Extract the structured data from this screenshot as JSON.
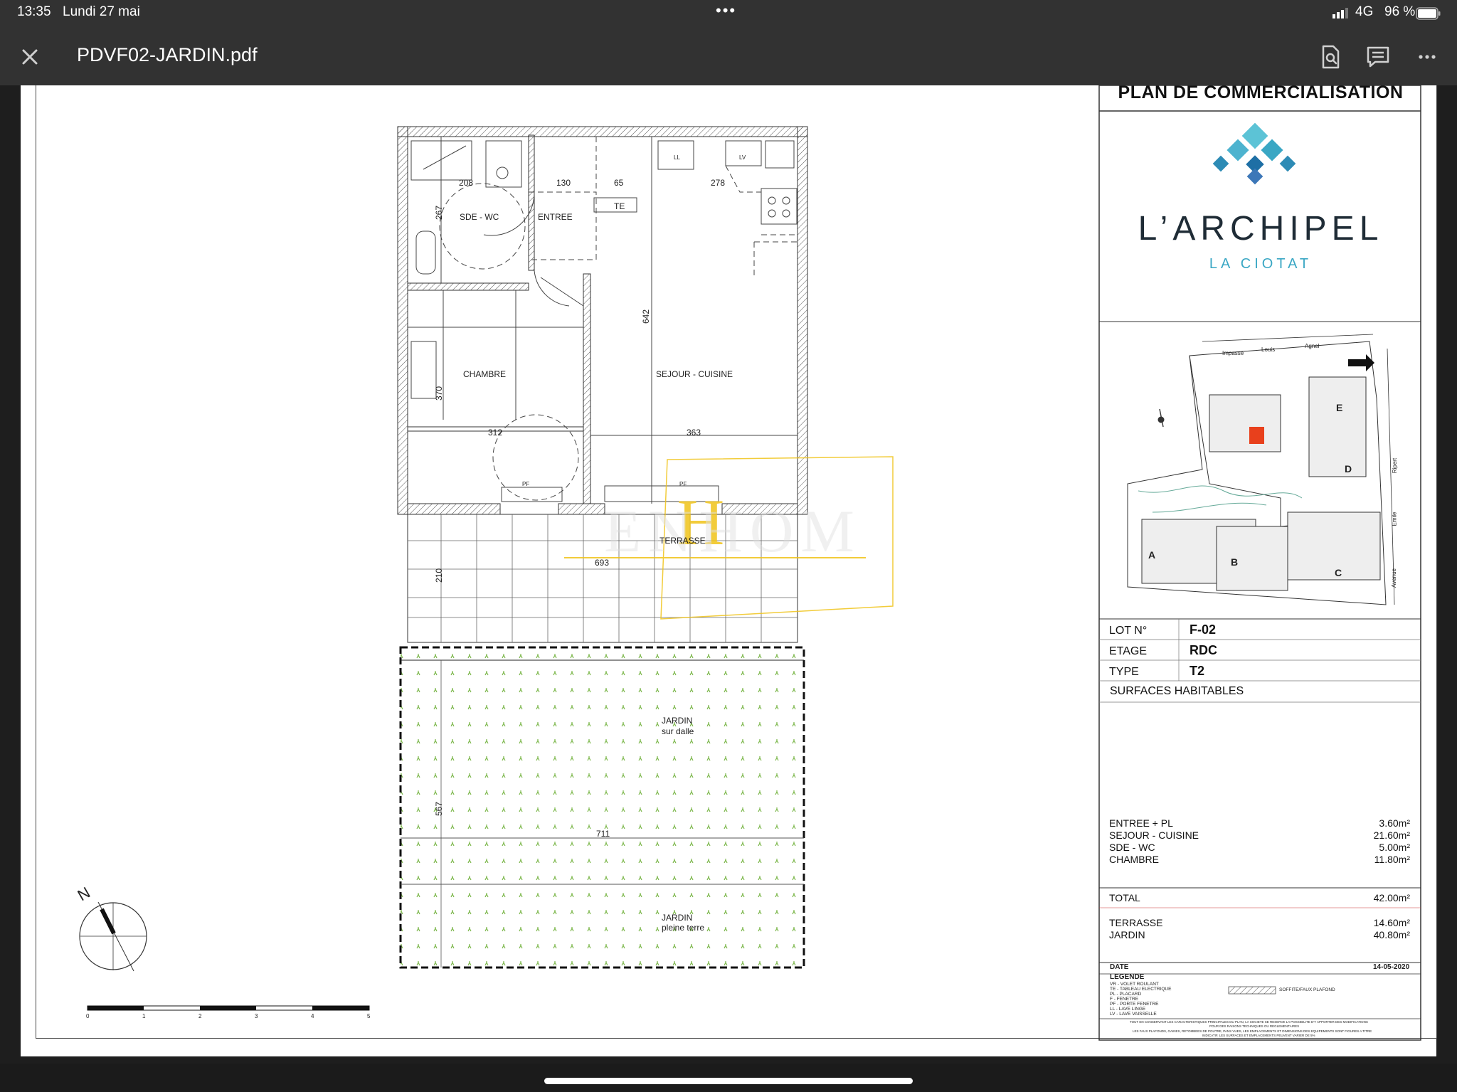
{
  "status": {
    "time": "13:35",
    "date": "Lundi 27 mai",
    "dots": "•••",
    "network": "4G",
    "battery": "96 %"
  },
  "toolbar": {
    "close_icon": "close-icon",
    "file_name": "PDVF02-JARDIN.pdf",
    "search_icon": "search-document-icon",
    "annotate_icon": "comment-icon",
    "more_icon": "more-icon"
  },
  "plan": {
    "rooms": {
      "sde_wc": "SDE - WC",
      "entree": "ENTREE",
      "te": "TE",
      "chambre": "CHAMBRE",
      "sejour": "SEJOUR - CUISINE",
      "terrasse": "TERRASSE",
      "jardin_dalle_1": "JARDIN",
      "jardin_dalle_2": "sur dalle",
      "jardin_terre_1": "JARDIN",
      "jardin_terre_2": "pleine terre"
    },
    "dims": {
      "d208": "208",
      "d130": "130",
      "d65": "65",
      "d278": "278",
      "d267": "267",
      "d642": "642",
      "d370": "370",
      "d312": "312",
      "d363": "363",
      "d693": "693",
      "d210": "210",
      "d567": "567",
      "d711": "711"
    },
    "fixtures": {
      "ll": "LL",
      "lv": "LV",
      "pf": "PF"
    },
    "compass_n": "N",
    "scale": [
      "0",
      "1",
      "2",
      "3",
      "4",
      "5"
    ]
  },
  "cartouche": {
    "title": "PLAN DE COMMERCIALISATION",
    "brand": "L’ARCHIPEL",
    "brand_sub": "LA CIOTAT",
    "map_labels": {
      "a": "A",
      "b": "B",
      "c": "C",
      "d": "D",
      "e": "E",
      "impasse": "Impasse",
      "louis": "Louis",
      "agnel": "Agnel",
      "ripert": "Ripert",
      "emile": "Emile",
      "avenue": "Avenue"
    },
    "lot_label": "LOT N°",
    "lot_value": "F-02",
    "etage_label": "ETAGE",
    "etage_value": "RDC",
    "type_label": "TYPE",
    "type_value": "T2",
    "surfaces_label": "SURFACES HABITABLES",
    "surfaces": [
      {
        "name": "ENTREE + PL",
        "value": "3.60m²"
      },
      {
        "name": "SEJOUR - CUISINE",
        "value": "21.60m²"
      },
      {
        "name": "SDE - WC",
        "value": "5.00m²"
      },
      {
        "name": "CHAMBRE",
        "value": "11.80m²"
      }
    ],
    "total_label": "TOTAL",
    "total_value": "42.00m²",
    "exterieurs": [
      {
        "name": "TERRASSE",
        "value": "14.60m²"
      },
      {
        "name": "JARDIN",
        "value": "40.80m²"
      }
    ],
    "date_label": "DATE",
    "date_value": "14-05-2020",
    "legende_label": "LEGENDE",
    "legend_items": [
      "VR - VOLET ROULANT",
      "TE - TABLEAU ELECTRIQUE",
      "PL - PLACARD",
      "F - FENETRE",
      "PF - PORTE FENETRE",
      "LL - LAVE LINGE",
      "LV - LAVE VAISSELLE"
    ],
    "legend_soffite": "SOFFITE/FAUX PLAFOND",
    "disclaimer_1": "TOUT EN CONSERVANT LES CARACTERISTIQUES PRINCIPALES DU PLAN, LA SOCIETE SE RESERVE LA POSSIBILITE D'Y APPORTER DES MODIFICATIONS",
    "disclaimer_2": "POUR DES RAISONS TECHNIQUES OU REGLEMENTAIRES",
    "disclaimer_3": "LES FAUX PLAFONDS, GAINES, RETOMBEES DE POUTRE, PANS VUES, LES EMPLACEMENTS ET DIMENSIONS DES EQUIPEMENTS SONT FIGURES A TITRE",
    "disclaimer_4": "INDICATIF. LES SURFACES ET EMPLACEMENTS PEUVENT VARIER DE 5%"
  },
  "colors": {
    "toolbar": "#323232",
    "accent_blue": "#3aa7c4",
    "brand_dark": "#1f2c36",
    "highlight_lot": "#e8401c",
    "watermark": "#f0c419",
    "grass": "#7ab648"
  }
}
